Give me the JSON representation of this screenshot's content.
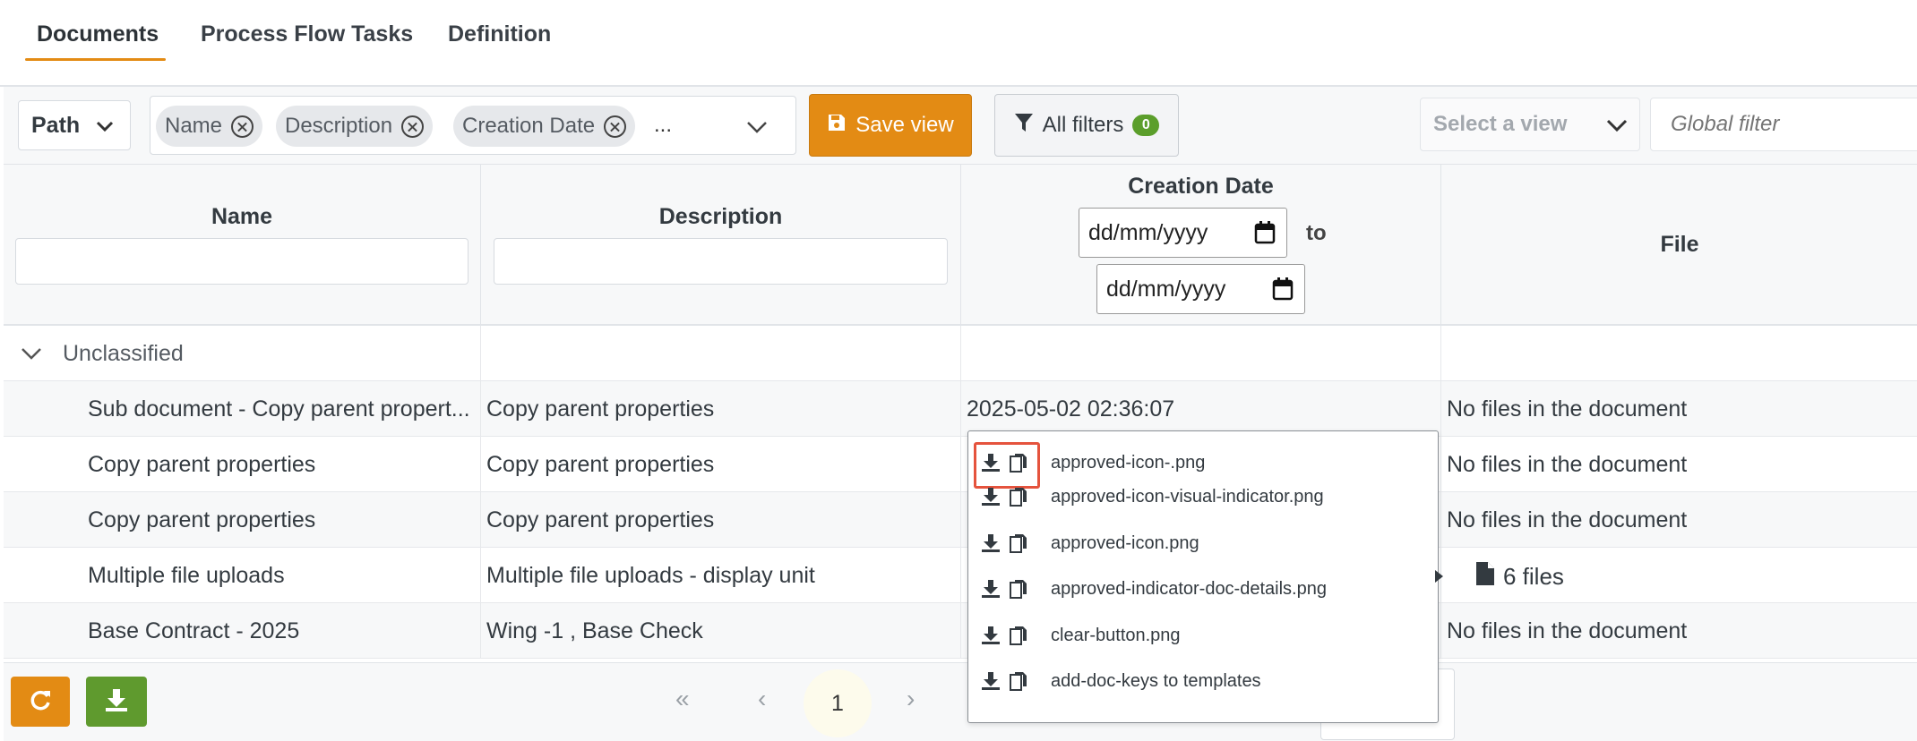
{
  "tabs": [
    {
      "label": "Documents",
      "active": true
    },
    {
      "label": "Process Flow Tasks",
      "active": false
    },
    {
      "label": "Definition",
      "active": false
    }
  ],
  "toolbar": {
    "path_label": "Path",
    "chips": [
      "Name",
      "Description",
      "Creation Date"
    ],
    "chips_more": "...",
    "save_view_label": "Save view",
    "all_filters_label": "All filters",
    "filters_count": "0",
    "select_view_placeholder": "Select a view",
    "global_filter_placeholder": "Global filter"
  },
  "table": {
    "headers": {
      "name": "Name",
      "description": "Description",
      "creation_date": "Creation Date",
      "file": "File"
    },
    "date_from_placeholder": "dd/mm/yyyy",
    "date_to_placeholder": "dd/mm/yyyy",
    "date_range_separator": "to",
    "group_label": "Unclassified",
    "rows": [
      {
        "name": "Sub document - Copy parent propert...",
        "description": "Copy parent properties",
        "date": "2025-05-02 02:36:07",
        "file": "No files in the document"
      },
      {
        "name": "Copy parent properties",
        "description": "Copy parent properties",
        "date": "",
        "file": "No files in the document"
      },
      {
        "name": "Copy parent properties",
        "description": "Copy parent properties",
        "date": "",
        "file": "No files in the document"
      },
      {
        "name": "Multiple file uploads",
        "description": "Multiple file uploads - display unit",
        "date": "",
        "file": "6 files"
      },
      {
        "name": "Base Contract - 2025",
        "description": "Wing -1 , Base Check",
        "date": "",
        "file": "No files in the document"
      }
    ]
  },
  "file_popup": {
    "files": [
      "approved-icon-.png",
      "approved-icon-visual-indicator.png",
      "approved-icon.png",
      "approved-indicator-doc-details.png",
      "clear-button.png",
      "add-doc-keys to templates"
    ]
  },
  "pagination": {
    "current_page": "1",
    "first": "«",
    "prev": "‹",
    "next": "›"
  },
  "colors": {
    "accent_orange": "#e38b14",
    "accent_green": "#5f9a2e",
    "highlight_red": "#e5533d"
  }
}
